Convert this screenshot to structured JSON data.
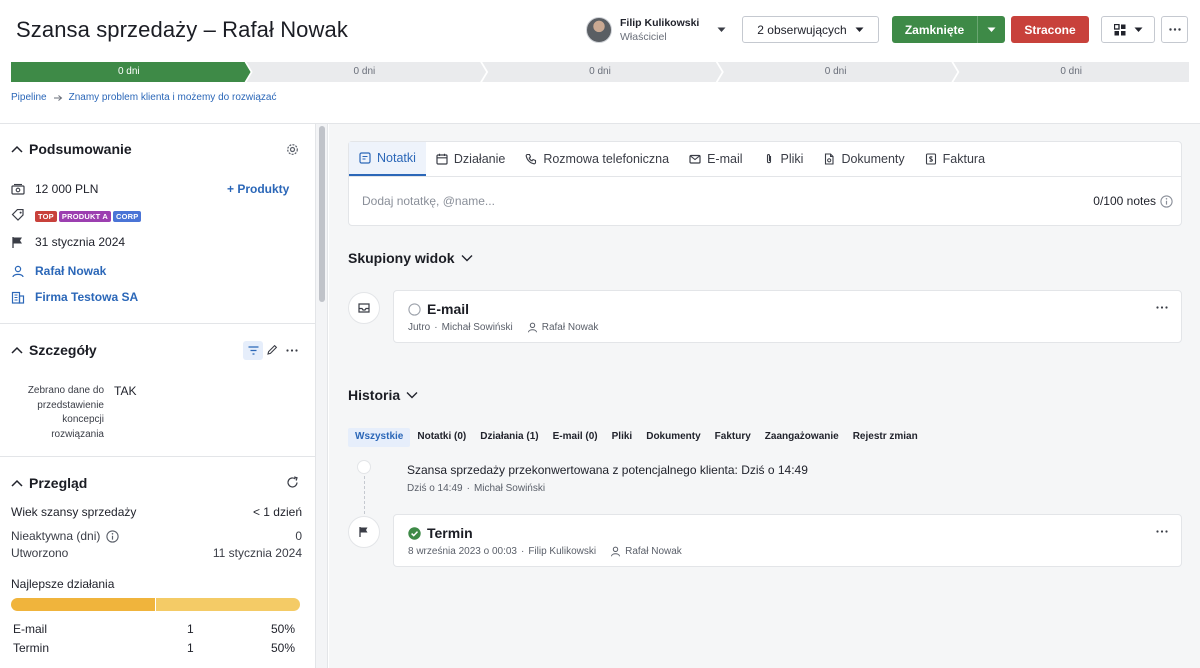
{
  "header": {
    "title": "Szansa sprzedaży – Rafał Nowak",
    "owner_name": "Filip Kulikowski",
    "owner_role": "Właściciel",
    "followers_label": "2 obserwujących",
    "won_label": "Zamknięte",
    "lost_label": "Stracone"
  },
  "stages": {
    "labels": [
      "0 dni",
      "0 dni",
      "0 dni",
      "0 dni",
      "0 dni"
    ],
    "active_index": 0,
    "active_color": "#3e8a47",
    "inactive_color": "#eaebed"
  },
  "breadcrumb": {
    "root": "Pipeline",
    "current": "Znamy problem klienta i możemy do rozwiązać"
  },
  "summary": {
    "title": "Podsumowanie",
    "value": "12 000 PLN",
    "products_label": "+ Produkty",
    "tags": [
      {
        "text": "TOP",
        "color": "#c8413b"
      },
      {
        "text": "PRODUKT A",
        "color": "#9c3fb0"
      },
      {
        "text": "CORP",
        "color": "#4a74d6"
      }
    ],
    "close_date": "31 stycznia 2024",
    "person": "Rafał Nowak",
    "organization": "Firma Testowa SA"
  },
  "details": {
    "title": "Szczegóły",
    "field_label": "Zebrano dane do przedstawienie koncepcji rozwiązania",
    "field_value": "TAK"
  },
  "overview": {
    "title": "Przegląd",
    "age_label": "Wiek szansy sprzedaży",
    "age_value": "< 1 dzień",
    "inactive_label": "Nieaktywna (dni)",
    "inactive_value": "0",
    "created_label": "Utworzono",
    "created_value": "11 stycznia 2024",
    "top_activities_label": "Najlepsze działania",
    "bar_colors": [
      "#f0b43c",
      "#f4cb66"
    ],
    "activities": [
      {
        "name": "E-mail",
        "count": "1",
        "percent": "50%",
        "share": 0.5
      },
      {
        "name": "Termin",
        "count": "1",
        "percent": "50%",
        "share": 0.5
      }
    ]
  },
  "composer": {
    "tabs": [
      "Notatki",
      "Działanie",
      "Rozmowa telefoniczna",
      "E-mail",
      "Pliki",
      "Dokumenty",
      "Faktura"
    ],
    "placeholder": "Dodaj notatkę, @name...",
    "counter": "0/100 notes"
  },
  "focused": {
    "title": "Skupiony widok",
    "item_title": "E-mail",
    "item_due": "Jutro",
    "item_user": "Michał Sowiński",
    "item_person": "Rafał Nowak"
  },
  "history": {
    "title": "Historia",
    "filters": [
      "Wszystkie",
      "Notatki (0)",
      "Działania (1)",
      "E-mail (0)",
      "Pliki",
      "Dokumenty",
      "Faktury",
      "Zaangażowanie",
      "Rejestr zmian"
    ],
    "event_text": "Szansa sprzedaży przekonwertowana z potencjalnego klienta: Dziś o 14:49",
    "event_time": "Dziś o 14:49",
    "event_user": "Michał Sowiński",
    "activity_title": "Termin",
    "activity_date": "8 września 2023 o 00:03",
    "activity_user": "Filip Kulikowski",
    "activity_person": "Rafał Nowak"
  }
}
